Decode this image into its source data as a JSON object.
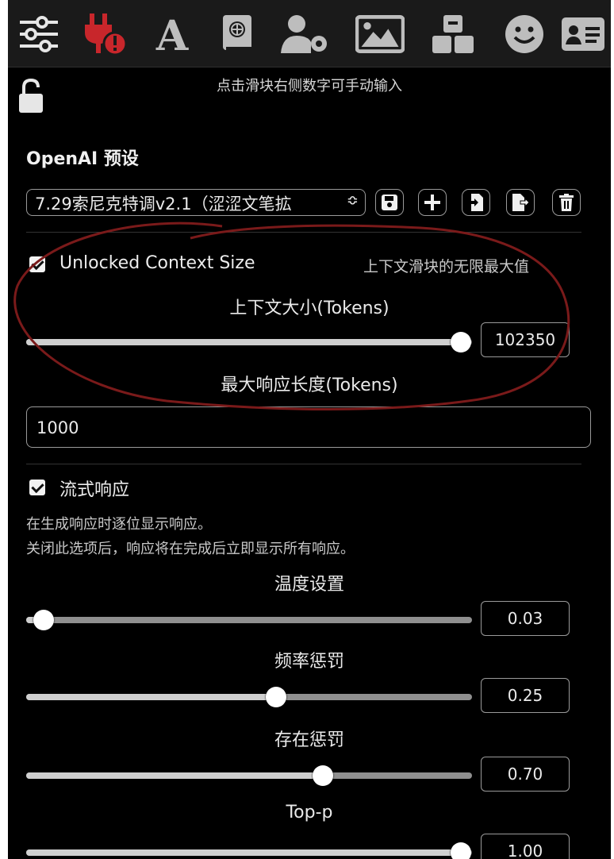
{
  "top_tabs": [
    {
      "icon": "sliders-icon",
      "color": "#e6e6e6"
    },
    {
      "icon": "plug-warning-icon",
      "color": "#c8262b"
    },
    {
      "icon": "font-a-icon",
      "color": "#bdbdbd"
    },
    {
      "icon": "book-globe-icon",
      "color": "#bdbdbd"
    },
    {
      "icon": "user-gear-icon",
      "color": "#bdbdbd"
    },
    {
      "icon": "image-icon",
      "color": "#bdbdbd"
    },
    {
      "icon": "cubes-icon",
      "color": "#bdbdbd"
    },
    {
      "icon": "smiley-icon",
      "color": "#bdbdbd"
    },
    {
      "icon": "id-card-icon",
      "color": "#bdbdbd"
    }
  ],
  "header": {
    "hint": "点击滑块右侧数字可手动输入",
    "lock_icon": "unlocked-padlock-icon"
  },
  "preset": {
    "title": "OpenAI 预设",
    "selected": "7.29索尼克特调v2.1（涩涩文笔拡",
    "chevron": "≎",
    "buttons": [
      {
        "icon": "save-icon"
      },
      {
        "icon": "plus-icon"
      },
      {
        "icon": "import-icon"
      },
      {
        "icon": "export-icon"
      },
      {
        "icon": "trash-icon"
      }
    ]
  },
  "context": {
    "unlocked_label": "Unlocked Context Size",
    "unlocked_checked": true,
    "unlocked_hint": "上下文滑块的无限最大值",
    "size_label": "上下文大小(Tokens)",
    "size_value": "102350",
    "size_fraction": 0.975,
    "max_resp_label": "最大响应长度(Tokens)",
    "max_resp_value": "1000"
  },
  "streaming": {
    "label": "流式响应",
    "checked": true,
    "desc1": "在生成响应时逐位显示响应。",
    "desc2": "关闭此选项后，响应将在完成后立即显示所有响应。"
  },
  "sliders": [
    {
      "label": "温度设置",
      "value": "0.03",
      "fraction": 0.04
    },
    {
      "label": "频率惩罚",
      "value": "0.25",
      "fraction": 0.56
    },
    {
      "label": "存在惩罚",
      "value": "0.70",
      "fraction": 0.665
    },
    {
      "label": "Top-p",
      "value": "1.00",
      "fraction": 0.975
    }
  ],
  "colors": {
    "background": "#000000",
    "topbar": "#1a1a1a",
    "annotation": "#7a1a1a"
  }
}
